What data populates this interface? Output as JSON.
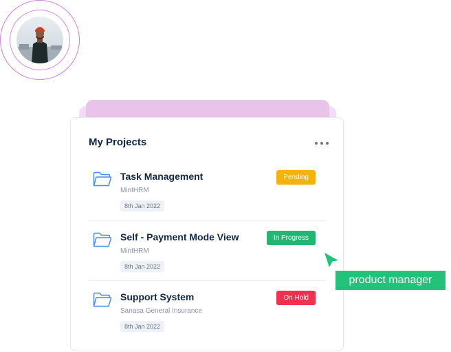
{
  "card": {
    "title": "My Projects",
    "more_icon": "more-horizontal-icon"
  },
  "projects": [
    {
      "name": "Task Management",
      "client": "MintHRM",
      "date": "8th Jan 2022",
      "status": "Pending",
      "status_color": "#f4b20c",
      "icon": "folder-icon"
    },
    {
      "name": "Self - Payment Mode View",
      "client": "MintHRM",
      "date": "8th Jan 2022",
      "status": "In Progress",
      "status_color": "#22b573",
      "icon": "folder-icon"
    },
    {
      "name": "Support System",
      "client": "Sanasa General Insurance",
      "date": "8th Jan 2022",
      "status": "On Hold",
      "status_color": "#f0304c",
      "icon": "folder-icon"
    }
  ],
  "cursor": {
    "icon": "pointer-cursor-icon",
    "color": "#22c27a"
  },
  "role_tag": {
    "label": "product manager",
    "color": "#22c27a"
  },
  "colors": {
    "title": "#0f2647",
    "accent_pink": "#d07be6",
    "folder": "#3d8bf7"
  }
}
